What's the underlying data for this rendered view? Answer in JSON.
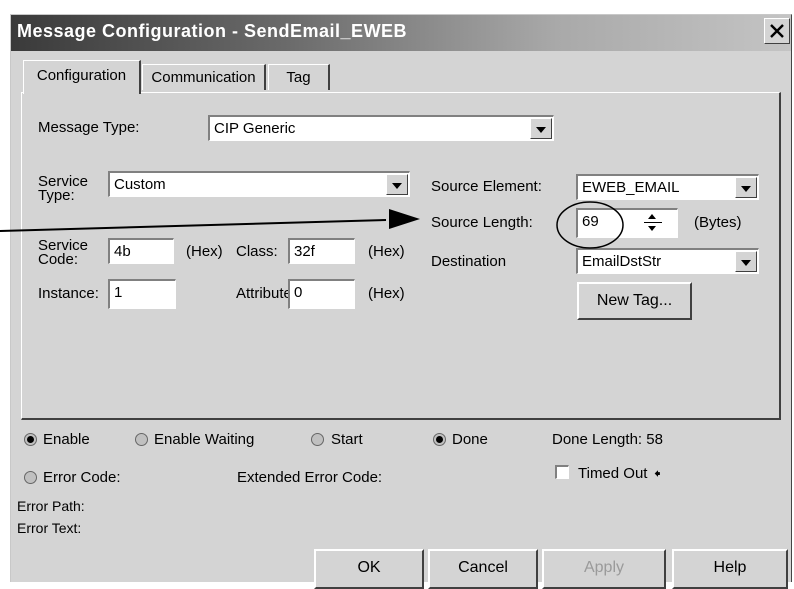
{
  "window": {
    "title": "Message Configuration - SendEmail_EWEB"
  },
  "tabs": [
    "Configuration",
    "Communication",
    "Tag"
  ],
  "config": {
    "message_type_label": "Message Type:",
    "message_type_value": "CIP Generic",
    "service_type_label": "Service Type:",
    "service_type_value": "Custom",
    "service_code_label": "Service Code:",
    "service_code_value": "4b",
    "hex_unit": "(Hex)",
    "class_label": "Class:",
    "class_value": "32f",
    "instance_label": "Instance:",
    "instance_value": "1",
    "attribute_label": "Attribute:",
    "attribute_value": "0",
    "source_element_label": "Source Element:",
    "source_element_value": "EWEB_EMAIL",
    "source_length_label": "Source Length:",
    "source_length_value": "69",
    "bytes_unit": "(Bytes)",
    "destination_label": "Destination",
    "destination_value": "EmailDstStr",
    "new_tag_label": "New Tag..."
  },
  "status": {
    "enable": "Enable",
    "enable_waiting": "Enable Waiting",
    "start": "Start",
    "done": "Done",
    "done_length": "Done Length: 58",
    "error_code": "Error Code:",
    "extended_error_code": "Extended Error Code:",
    "timed_out": "Timed Out",
    "timed_out_marker": "🠸",
    "error_path": "Error Path:",
    "error_text": "Error Text:"
  },
  "buttons": {
    "ok": "OK",
    "cancel": "Cancel",
    "apply": "Apply",
    "help": "Help"
  }
}
